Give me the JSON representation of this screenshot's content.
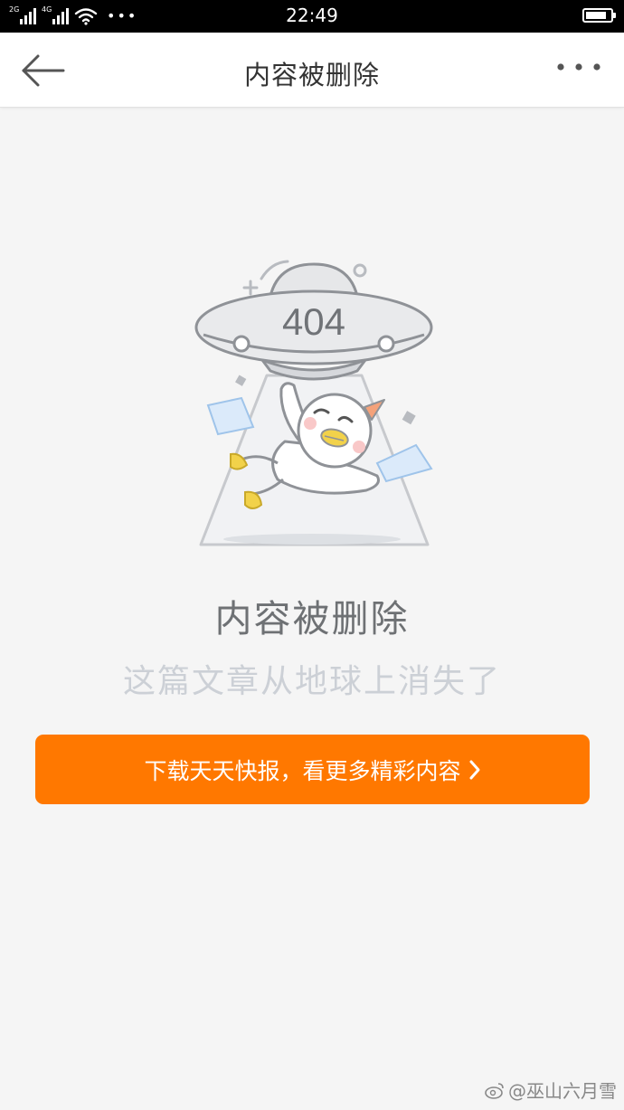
{
  "status_bar": {
    "signal1_label": "2G",
    "signal2_label": "4G",
    "time": "22:49",
    "battery_level": 0.85
  },
  "header": {
    "title": "内容被删除"
  },
  "illustration": {
    "code": "404"
  },
  "message": {
    "title": "内容被删除",
    "subtitle": "这篇文章从地球上消失了"
  },
  "cta": {
    "label": "下载天天快报，看更多精彩内容"
  },
  "watermark": {
    "text": "@巫山六月雪"
  },
  "colors": {
    "accent": "#ff7800",
    "title": "#6e7174",
    "subtitle": "#ccd0d6",
    "background": "#f5f5f5"
  }
}
